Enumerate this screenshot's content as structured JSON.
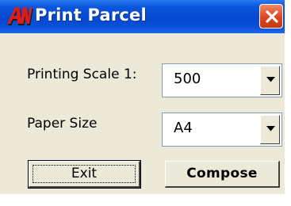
{
  "window": {
    "title": "Print Parcel",
    "icon": "app-logo-icon",
    "close_icon": "close-icon",
    "accent_color": "#0a4fd8",
    "close_color": "#d9451e"
  },
  "form": {
    "scale_label": "Printing Scale 1:",
    "scale_value": "500",
    "paper_label": "Paper Size",
    "paper_value": "A4"
  },
  "buttons": {
    "exit_label": "Exit",
    "compose_label": "Compose"
  }
}
